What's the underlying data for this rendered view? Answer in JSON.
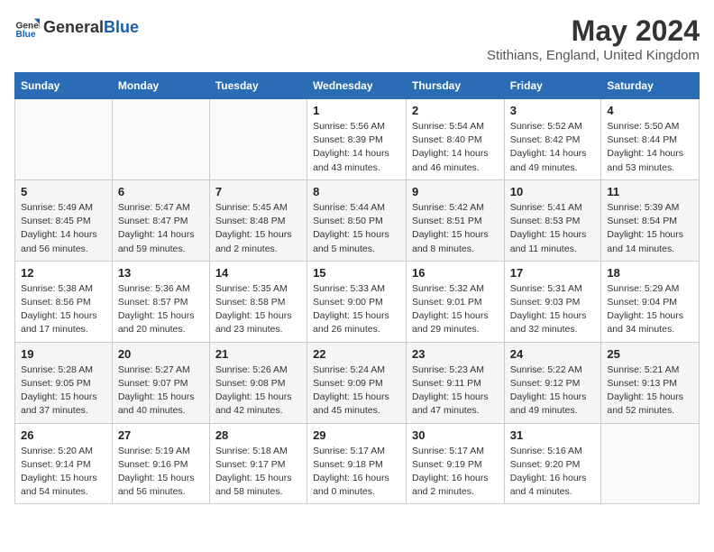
{
  "header": {
    "logo_general": "General",
    "logo_blue": "Blue",
    "month_title": "May 2024",
    "location": "Stithians, England, United Kingdom"
  },
  "weekdays": [
    "Sunday",
    "Monday",
    "Tuesday",
    "Wednesday",
    "Thursday",
    "Friday",
    "Saturday"
  ],
  "weeks": [
    [
      {
        "day": "",
        "info": ""
      },
      {
        "day": "",
        "info": ""
      },
      {
        "day": "",
        "info": ""
      },
      {
        "day": "1",
        "info": "Sunrise: 5:56 AM\nSunset: 8:39 PM\nDaylight: 14 hours\nand 43 minutes."
      },
      {
        "day": "2",
        "info": "Sunrise: 5:54 AM\nSunset: 8:40 PM\nDaylight: 14 hours\nand 46 minutes."
      },
      {
        "day": "3",
        "info": "Sunrise: 5:52 AM\nSunset: 8:42 PM\nDaylight: 14 hours\nand 49 minutes."
      },
      {
        "day": "4",
        "info": "Sunrise: 5:50 AM\nSunset: 8:44 PM\nDaylight: 14 hours\nand 53 minutes."
      }
    ],
    [
      {
        "day": "5",
        "info": "Sunrise: 5:49 AM\nSunset: 8:45 PM\nDaylight: 14 hours\nand 56 minutes."
      },
      {
        "day": "6",
        "info": "Sunrise: 5:47 AM\nSunset: 8:47 PM\nDaylight: 14 hours\nand 59 minutes."
      },
      {
        "day": "7",
        "info": "Sunrise: 5:45 AM\nSunset: 8:48 PM\nDaylight: 15 hours\nand 2 minutes."
      },
      {
        "day": "8",
        "info": "Sunrise: 5:44 AM\nSunset: 8:50 PM\nDaylight: 15 hours\nand 5 minutes."
      },
      {
        "day": "9",
        "info": "Sunrise: 5:42 AM\nSunset: 8:51 PM\nDaylight: 15 hours\nand 8 minutes."
      },
      {
        "day": "10",
        "info": "Sunrise: 5:41 AM\nSunset: 8:53 PM\nDaylight: 15 hours\nand 11 minutes."
      },
      {
        "day": "11",
        "info": "Sunrise: 5:39 AM\nSunset: 8:54 PM\nDaylight: 15 hours\nand 14 minutes."
      }
    ],
    [
      {
        "day": "12",
        "info": "Sunrise: 5:38 AM\nSunset: 8:56 PM\nDaylight: 15 hours\nand 17 minutes."
      },
      {
        "day": "13",
        "info": "Sunrise: 5:36 AM\nSunset: 8:57 PM\nDaylight: 15 hours\nand 20 minutes."
      },
      {
        "day": "14",
        "info": "Sunrise: 5:35 AM\nSunset: 8:58 PM\nDaylight: 15 hours\nand 23 minutes."
      },
      {
        "day": "15",
        "info": "Sunrise: 5:33 AM\nSunset: 9:00 PM\nDaylight: 15 hours\nand 26 minutes."
      },
      {
        "day": "16",
        "info": "Sunrise: 5:32 AM\nSunset: 9:01 PM\nDaylight: 15 hours\nand 29 minutes."
      },
      {
        "day": "17",
        "info": "Sunrise: 5:31 AM\nSunset: 9:03 PM\nDaylight: 15 hours\nand 32 minutes."
      },
      {
        "day": "18",
        "info": "Sunrise: 5:29 AM\nSunset: 9:04 PM\nDaylight: 15 hours\nand 34 minutes."
      }
    ],
    [
      {
        "day": "19",
        "info": "Sunrise: 5:28 AM\nSunset: 9:05 PM\nDaylight: 15 hours\nand 37 minutes."
      },
      {
        "day": "20",
        "info": "Sunrise: 5:27 AM\nSunset: 9:07 PM\nDaylight: 15 hours\nand 40 minutes."
      },
      {
        "day": "21",
        "info": "Sunrise: 5:26 AM\nSunset: 9:08 PM\nDaylight: 15 hours\nand 42 minutes."
      },
      {
        "day": "22",
        "info": "Sunrise: 5:24 AM\nSunset: 9:09 PM\nDaylight: 15 hours\nand 45 minutes."
      },
      {
        "day": "23",
        "info": "Sunrise: 5:23 AM\nSunset: 9:11 PM\nDaylight: 15 hours\nand 47 minutes."
      },
      {
        "day": "24",
        "info": "Sunrise: 5:22 AM\nSunset: 9:12 PM\nDaylight: 15 hours\nand 49 minutes."
      },
      {
        "day": "25",
        "info": "Sunrise: 5:21 AM\nSunset: 9:13 PM\nDaylight: 15 hours\nand 52 minutes."
      }
    ],
    [
      {
        "day": "26",
        "info": "Sunrise: 5:20 AM\nSunset: 9:14 PM\nDaylight: 15 hours\nand 54 minutes."
      },
      {
        "day": "27",
        "info": "Sunrise: 5:19 AM\nSunset: 9:16 PM\nDaylight: 15 hours\nand 56 minutes."
      },
      {
        "day": "28",
        "info": "Sunrise: 5:18 AM\nSunset: 9:17 PM\nDaylight: 15 hours\nand 58 minutes."
      },
      {
        "day": "29",
        "info": "Sunrise: 5:17 AM\nSunset: 9:18 PM\nDaylight: 16 hours\nand 0 minutes."
      },
      {
        "day": "30",
        "info": "Sunrise: 5:17 AM\nSunset: 9:19 PM\nDaylight: 16 hours\nand 2 minutes."
      },
      {
        "day": "31",
        "info": "Sunrise: 5:16 AM\nSunset: 9:20 PM\nDaylight: 16 hours\nand 4 minutes."
      },
      {
        "day": "",
        "info": ""
      }
    ]
  ]
}
